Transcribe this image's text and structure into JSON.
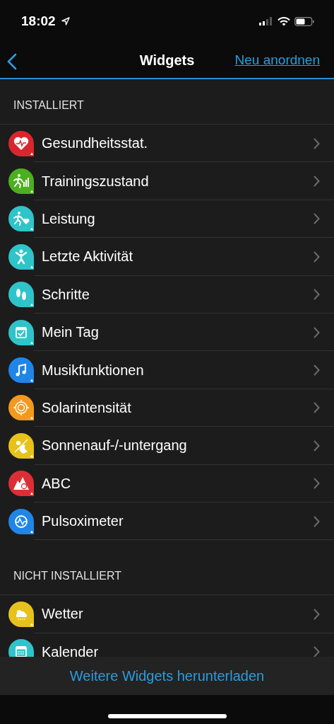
{
  "status_bar": {
    "time": "18:02"
  },
  "nav": {
    "title": "Widgets",
    "action": "Neu anordnen"
  },
  "sections": [
    {
      "title": "INSTALLIERT",
      "items": [
        {
          "label": "Gesundheitsstat.",
          "color": "#d9262e"
        },
        {
          "label": "Trainingszustand",
          "color": "#4caf1e"
        },
        {
          "label": "Leistung",
          "color": "#2ec4c9"
        },
        {
          "label": "Letzte Aktivität",
          "color": "#2ec4c9"
        },
        {
          "label": "Schritte",
          "color": "#2ec4c9"
        },
        {
          "label": "Mein Tag",
          "color": "#2ec4c9"
        },
        {
          "label": "Musikfunktionen",
          "color": "#1f86e8"
        },
        {
          "label": "Solarintensität",
          "color": "#f39a1c"
        },
        {
          "label": "Sonnenauf-/-untergang",
          "color": "#e8c21a"
        },
        {
          "label": "ABC",
          "color": "#dc2f35"
        },
        {
          "label": "Pulsoximeter",
          "color": "#1f86e8"
        }
      ]
    },
    {
      "title": "NICHT INSTALLIERT",
      "items": [
        {
          "label": "Wetter",
          "color": "#e8c21a"
        },
        {
          "label": "Kalender",
          "color": "#2ec4c9"
        }
      ]
    }
  ],
  "footer": {
    "link": "Weitere Widgets herunterladen"
  }
}
